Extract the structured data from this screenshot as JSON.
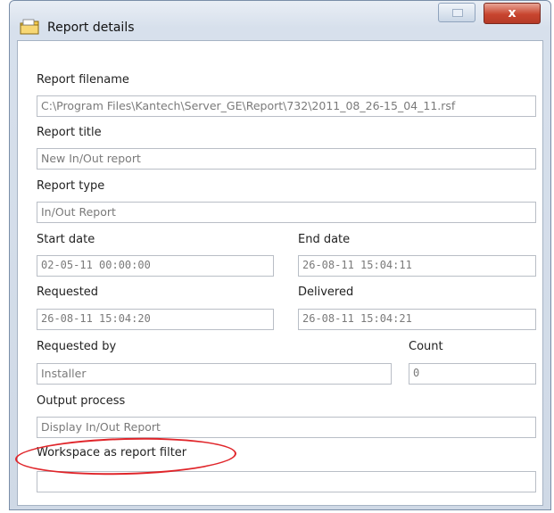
{
  "window": {
    "title": "Report details",
    "icon": "folder-report-icon",
    "close_label": "x"
  },
  "fields": {
    "report_filename": {
      "label": "Report filename",
      "value": "C:\\Program Files\\Kantech\\Server_GE\\Report\\732\\2011_08_26-15_04_11.rsf"
    },
    "report_title": {
      "label": "Report title",
      "value": "New In/Out report"
    },
    "report_type": {
      "label": "Report type",
      "value": "In/Out Report"
    },
    "start_date": {
      "label": "Start date",
      "value": "02-05-11 00:00:00"
    },
    "end_date": {
      "label": "End date",
      "value": "26-08-11 15:04:11"
    },
    "requested": {
      "label": "Requested",
      "value": "26-08-11 15:04:20"
    },
    "delivered": {
      "label": "Delivered",
      "value": "26-08-11 15:04:21"
    },
    "requested_by": {
      "label": "Requested by",
      "value": "Installer"
    },
    "count": {
      "label": "Count",
      "value": "0"
    },
    "output_process": {
      "label": "Output process",
      "value": "Display In/Out Report"
    },
    "workspace_filter": {
      "label": "Workspace as report filter",
      "value": ""
    }
  },
  "colors": {
    "highlight": "#e0252a",
    "close_button": "#c8452f"
  }
}
